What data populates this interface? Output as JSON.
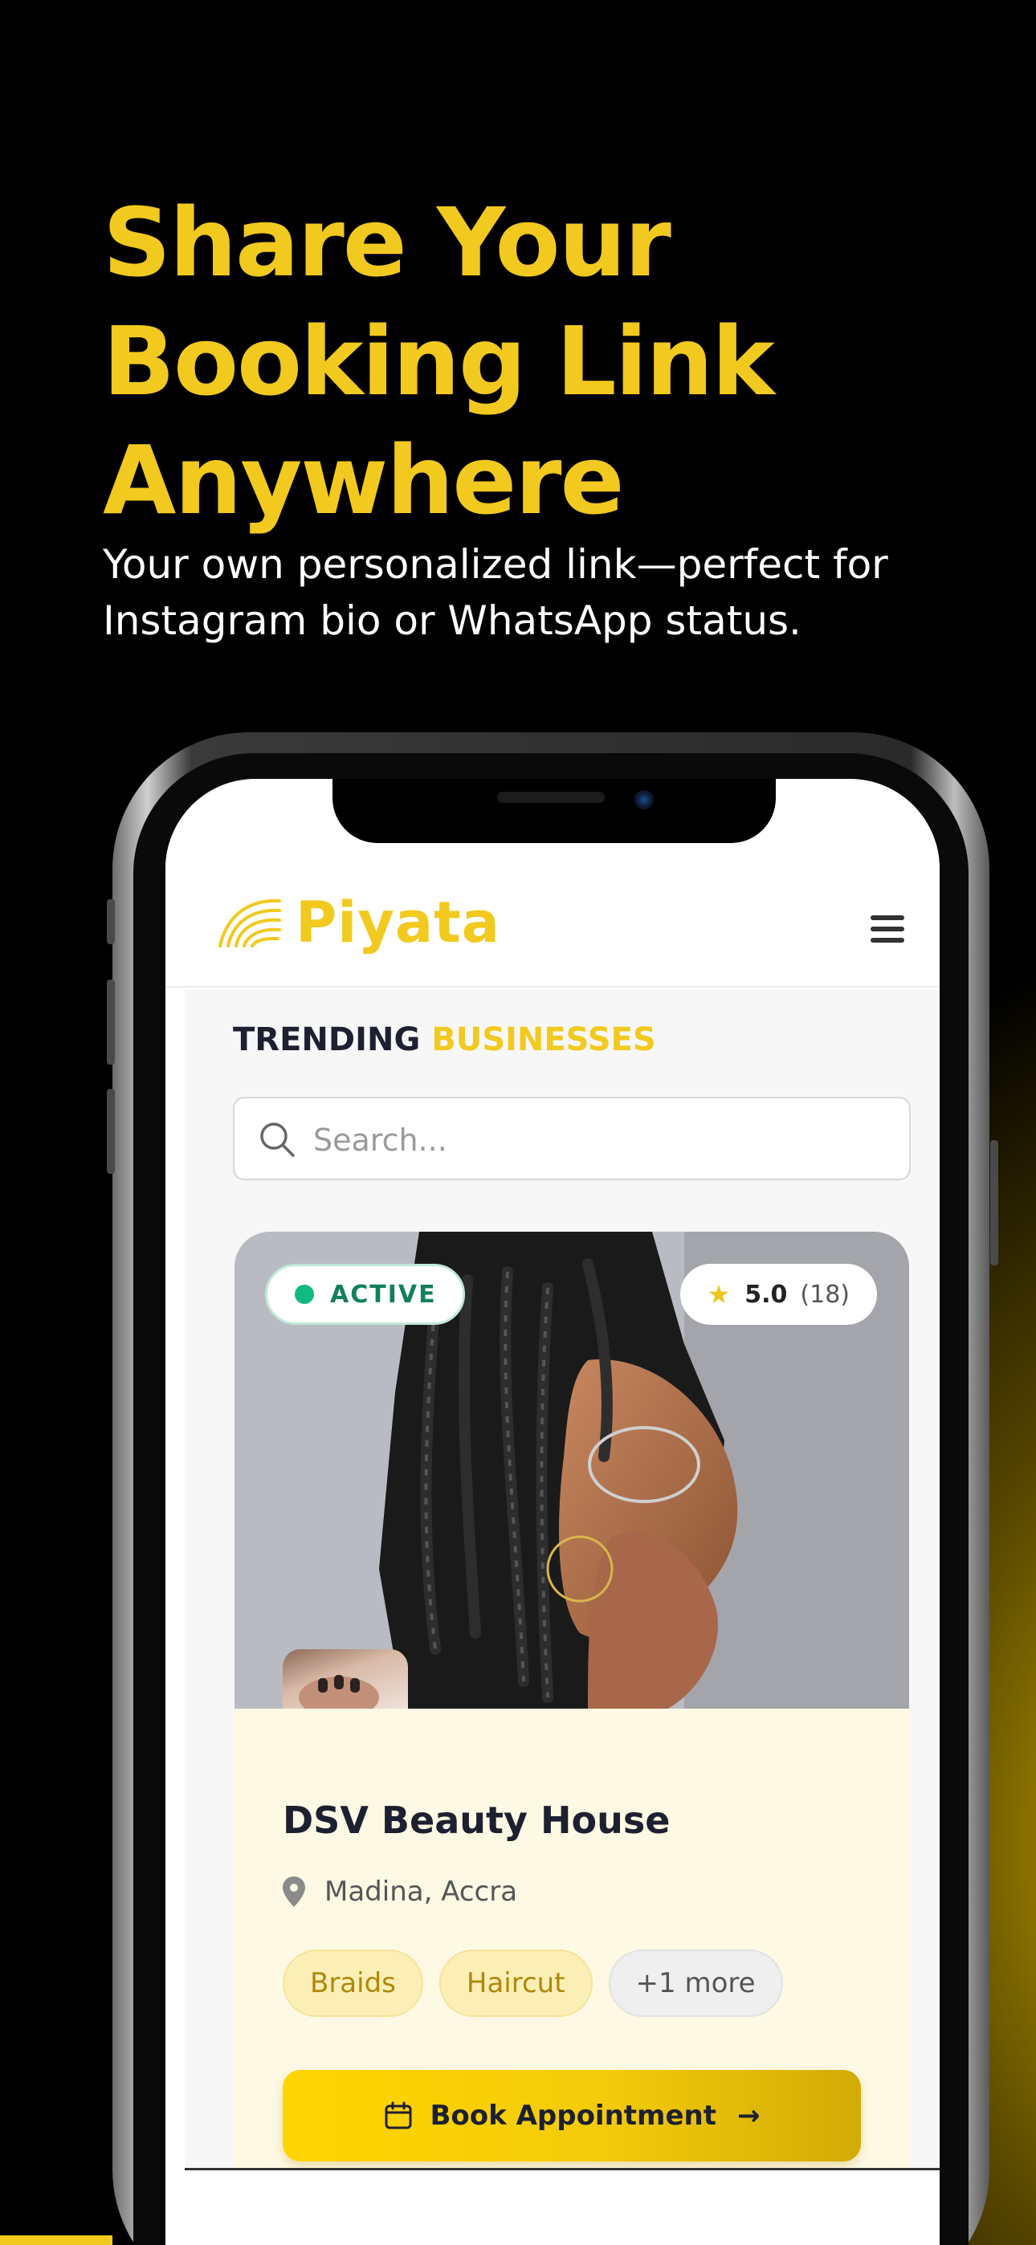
{
  "promo": {
    "headline": "Share Your Booking Link Anywhere",
    "subline": "Your own personalized link—perfect for Instagram bio or WhatsApp status."
  },
  "app": {
    "brand": "Piyata",
    "brand_color": "#F2C91E",
    "section_title_part1": "TRENDING",
    "section_title_part2": "BUSINESSES",
    "search": {
      "placeholder": "Search..."
    },
    "menu_icon": "hamburger-icon"
  },
  "business_card": {
    "status": "ACTIVE",
    "rating": "5.0",
    "review_count": "(18)",
    "name": "DSV Beauty House",
    "location": "Madina, Accra",
    "tags": [
      "Braids",
      "Haircut",
      "+1 more"
    ],
    "book_label": "Book Appointment",
    "icons": {
      "status": "green-dot-icon",
      "rating": "star-icon",
      "location": "map-pin-icon",
      "book": "calendar-icon",
      "arrow": "arrow-right-icon"
    }
  }
}
